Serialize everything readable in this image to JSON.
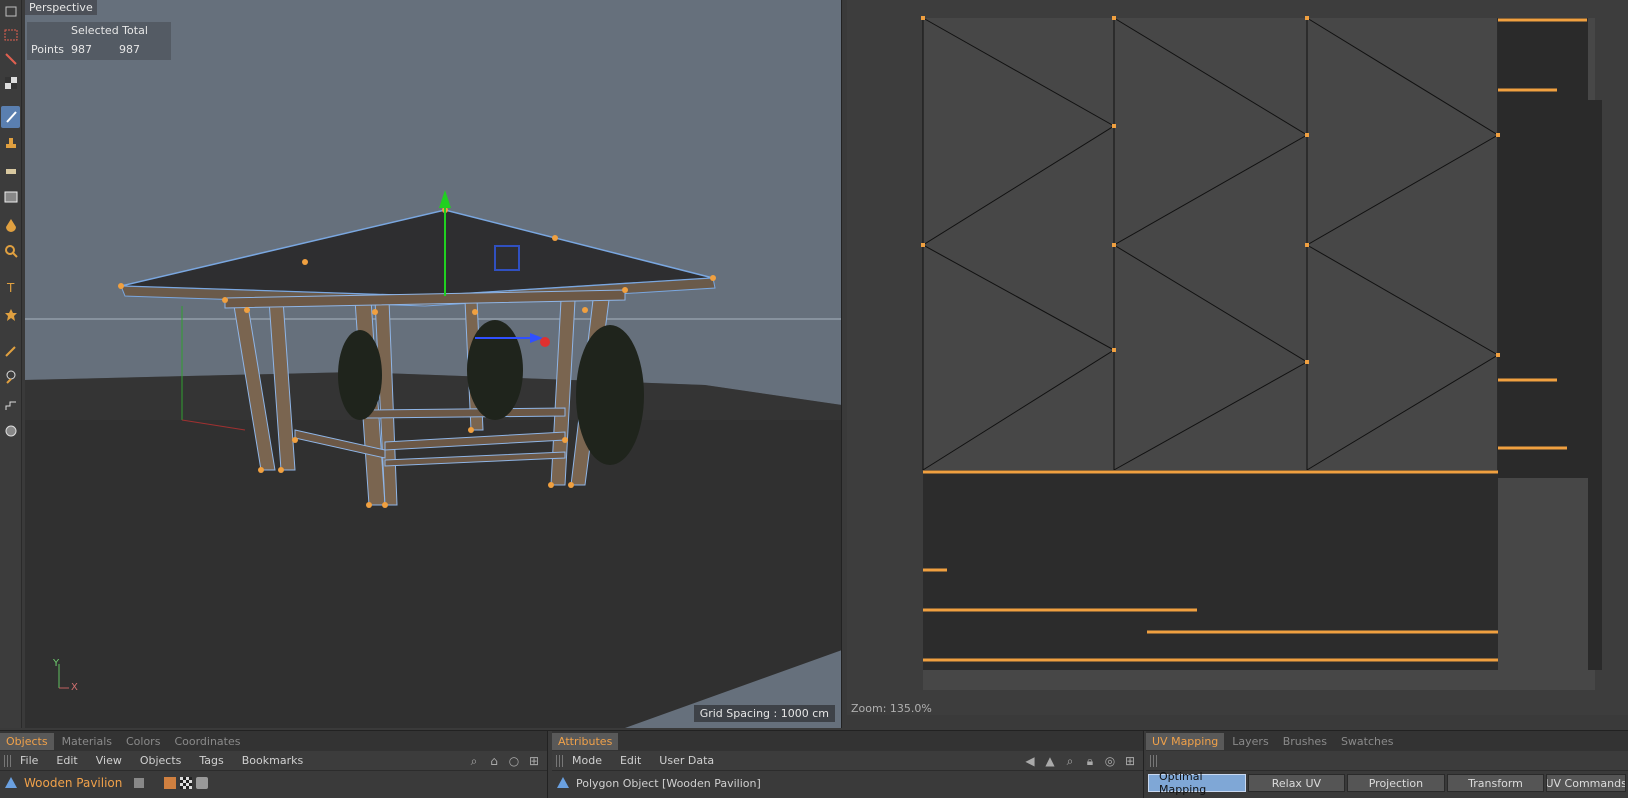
{
  "viewport": {
    "title": "Perspective",
    "hud": {
      "header": "Selected Total",
      "row_label": "Points",
      "selected": "987",
      "total": "987"
    },
    "grid_spacing": "Grid Spacing : 1000 cm",
    "axis_y": "Y",
    "axis_x": "X"
  },
  "uv": {
    "zoom": "Zoom: 135.0%"
  },
  "objects_panel": {
    "tabs": [
      "Objects",
      "Materials",
      "Colors",
      "Coordinates"
    ],
    "menu": [
      "File",
      "Edit",
      "View",
      "Objects",
      "Tags",
      "Bookmarks"
    ],
    "object_name": "Wooden Pavilion"
  },
  "attributes_panel": {
    "tab": "Attributes",
    "menu": [
      "Mode",
      "Edit",
      "User Data"
    ],
    "object_label": "Polygon Object [Wooden Pavilion]"
  },
  "uv_panel": {
    "tabs": [
      "UV Mapping",
      "Layers",
      "Brushes",
      "Swatches"
    ],
    "buttons": [
      "Optimal Mapping",
      "Relax UV",
      "Projection",
      "Transform",
      "UV Commands"
    ]
  },
  "colors": {
    "accent": "#f0a14a",
    "selection_blue": "#5a7fb0",
    "viewport_bg": "#66707c",
    "uv_bg": "#3d3d3d"
  }
}
